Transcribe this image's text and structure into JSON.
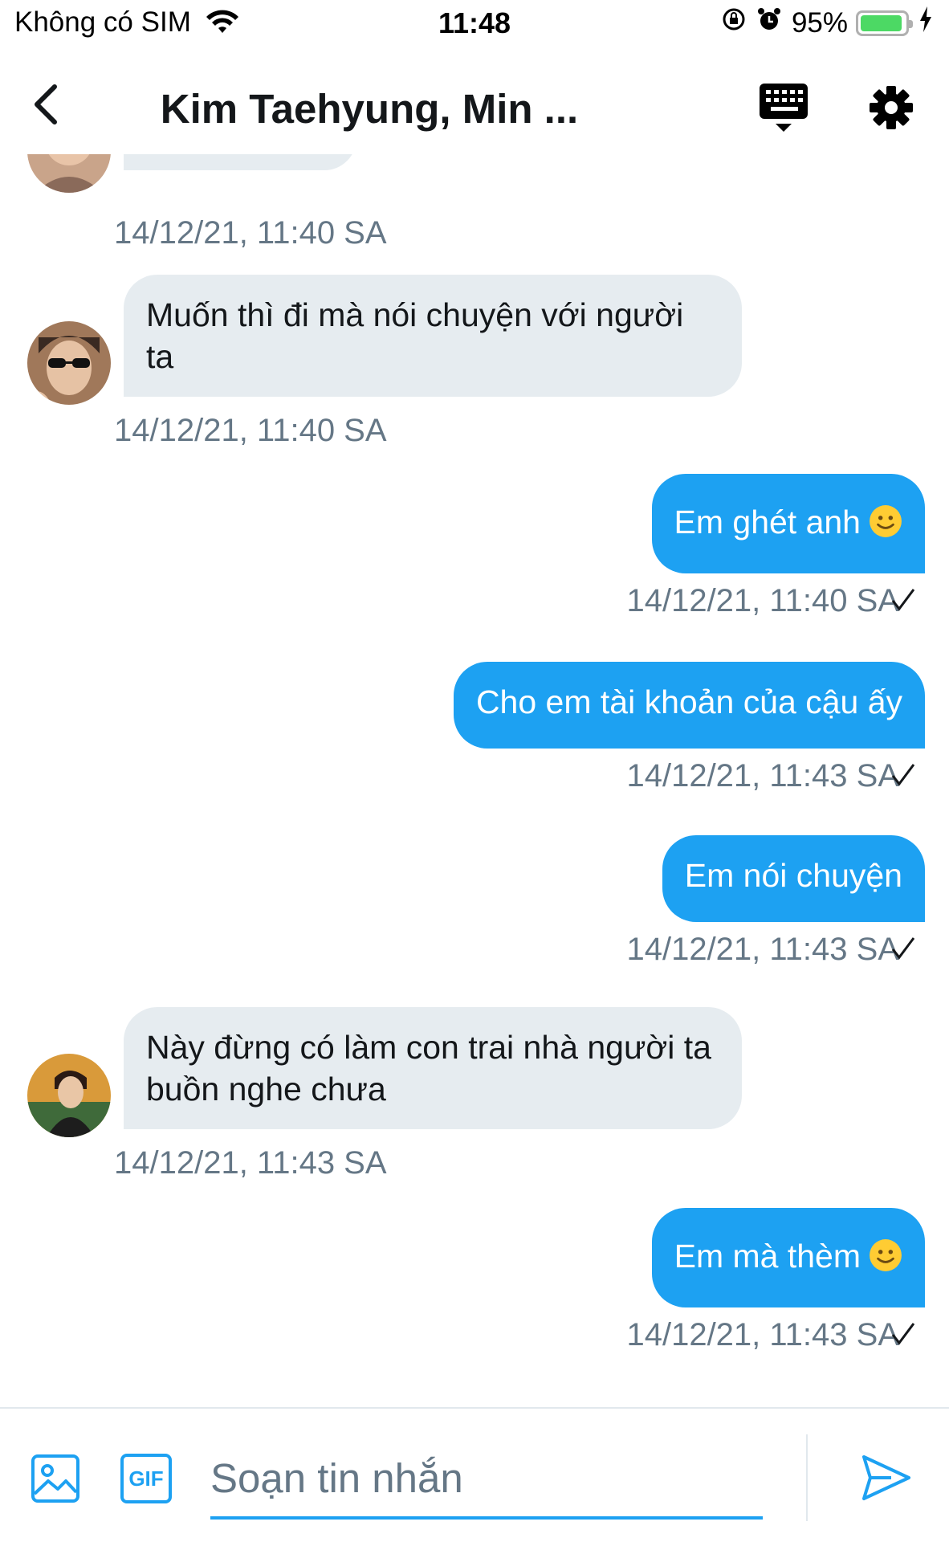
{
  "status_bar": {
    "carrier": "Không có SIM",
    "time": "11:48",
    "battery_percent": "95%",
    "battery_level": 0.95,
    "icons": [
      "wifi-icon",
      "orientation-lock-icon",
      "alarm-icon",
      "battery-icon",
      "charging-icon"
    ]
  },
  "header": {
    "title": "Kim Taehyung, Min ...",
    "icons": [
      "back-chevron-icon",
      "keyboard-icon",
      "gear-icon"
    ]
  },
  "messages": [
    {
      "direction": "in",
      "text": "",
      "time": "14/12/21, 11:40 SA"
    },
    {
      "direction": "in",
      "text": "Muốn thì đi mà nói chuyện với người ta",
      "time": "14/12/21, 11:40 SA"
    },
    {
      "direction": "out",
      "text": "Em ghét anh",
      "emoji": "slightly-smiling-face",
      "time": "14/12/21, 11:40 SA"
    },
    {
      "direction": "out",
      "text": "Cho em tài khoản của cậu ấy",
      "time": "14/12/21, 11:43 SA"
    },
    {
      "direction": "out",
      "text": "Em nói chuyện",
      "time": "14/12/21, 11:43 SA"
    },
    {
      "direction": "in",
      "text": "Này đừng có làm con trai nhà người ta buồn nghe chưa",
      "time": "14/12/21, 11:43 SA"
    },
    {
      "direction": "out",
      "text": "Em mà thèm",
      "emoji": "slightly-smiling-face",
      "time": "14/12/21, 11:43 SA"
    }
  ],
  "composer": {
    "placeholder": "Soạn tin nhắn",
    "value": "",
    "gif_label": "GIF",
    "icons": [
      "image-icon",
      "gif-icon",
      "send-icon"
    ]
  },
  "colors": {
    "accent": "#1da1f2",
    "incoming_bubble": "#e6ecf0",
    "timestamp": "#657786",
    "battery": "#4cd964"
  }
}
